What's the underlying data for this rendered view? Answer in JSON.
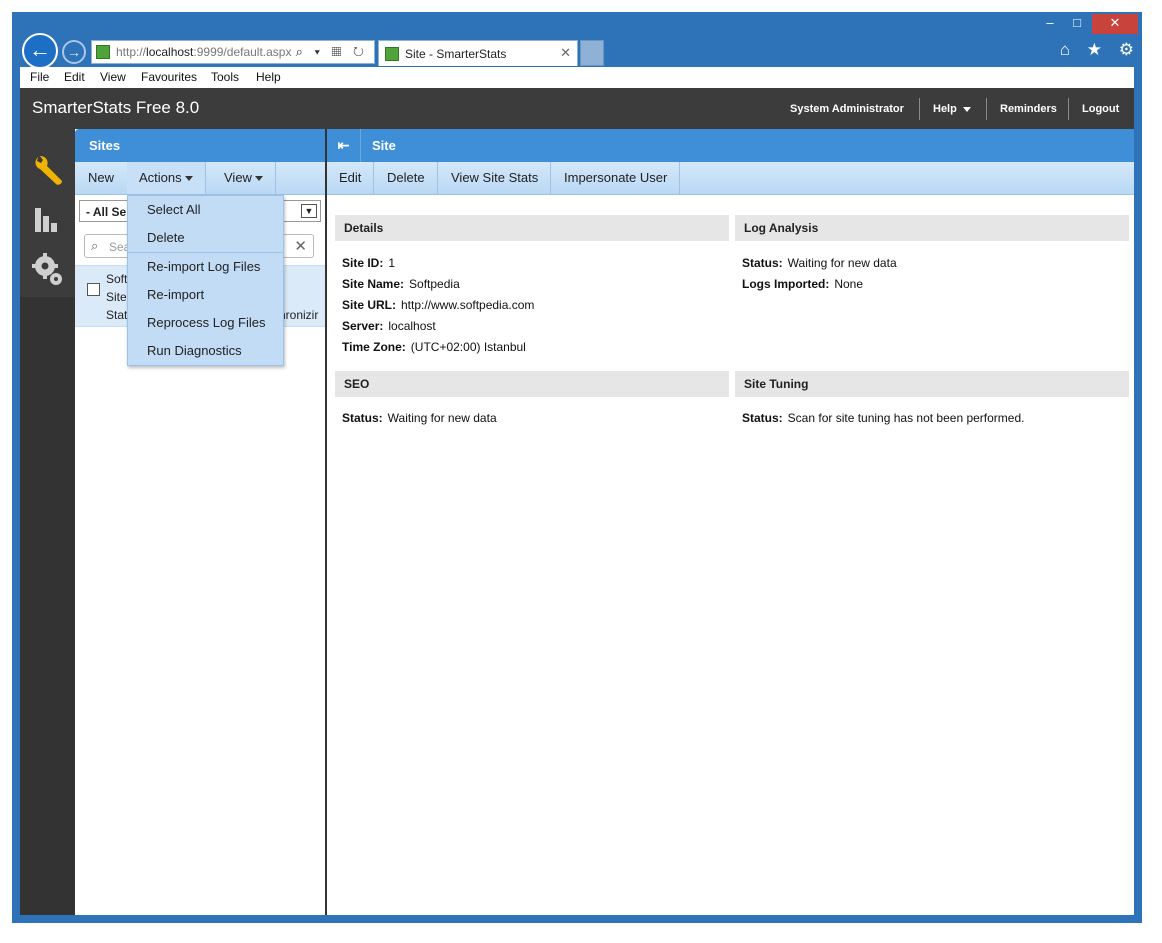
{
  "browser": {
    "address_scheme": "http://",
    "address_host": "localhost",
    "address_rest": ":9999/default.aspx",
    "address_icons": "⌕ ▾ ▦ ↻",
    "tab_title": "Site - SmarterStats",
    "tab_close": "✕",
    "tools_icons": "⌂ ★ ⚙",
    "window_buttons": {
      "minimize": "–",
      "maximize": "□",
      "close": "✕"
    },
    "back_glyph": "←",
    "forward_glyph": "→"
  },
  "menubar": [
    "File",
    "Edit",
    "View",
    "Favourites",
    "Tools",
    "Help"
  ],
  "app": {
    "title": "SmarterStats Free 8.0",
    "user": "System Administrator",
    "help": "Help",
    "reminders": "Reminders",
    "logout": "Logout"
  },
  "icons": {
    "settings": "wrench-icon",
    "stats": "bar-chart-icon",
    "admin": "gears-icon",
    "accent": "#f0b400"
  },
  "sites_pane": {
    "title": "Sites",
    "toolbar": {
      "new": "New",
      "actions": "Actions",
      "view": "View"
    },
    "filter_value": "- All Ser",
    "search_placeholder": "Sea",
    "row": {
      "line1": "Soft",
      "line2": "Site",
      "line3": "Stat",
      "sync": "chronizir"
    }
  },
  "actions_menu": [
    "Select All",
    "Delete",
    "Re-import Log Files",
    "Re-import",
    "Reprocess Log Files",
    "Run Diagnostics"
  ],
  "site_pane": {
    "title": "Site",
    "toolbar": [
      "Edit",
      "Delete",
      "View Site Stats",
      "Impersonate User"
    ],
    "details": {
      "title": "Details",
      "rows": [
        {
          "label": "Site ID:",
          "value": "1"
        },
        {
          "label": "Site Name:",
          "value": "Softpedia"
        },
        {
          "label": "Site URL:",
          "value": "http://www.softpedia.com"
        },
        {
          "label": "Server:",
          "value": "localhost"
        },
        {
          "label": "Time Zone:",
          "value": "(UTC+02:00) Istanbul"
        }
      ]
    },
    "log_analysis": {
      "title": "Log Analysis",
      "rows": [
        {
          "label": "Status:",
          "value": "Waiting for new data"
        },
        {
          "label": "Logs Imported:",
          "value": "None"
        }
      ]
    },
    "seo": {
      "title": "SEO",
      "rows": [
        {
          "label": "Status:",
          "value": "Waiting for new data"
        }
      ]
    },
    "site_tuning": {
      "title": "Site Tuning",
      "rows": [
        {
          "label": "Status:",
          "value": "Scan for site tuning has not been performed."
        }
      ]
    }
  }
}
